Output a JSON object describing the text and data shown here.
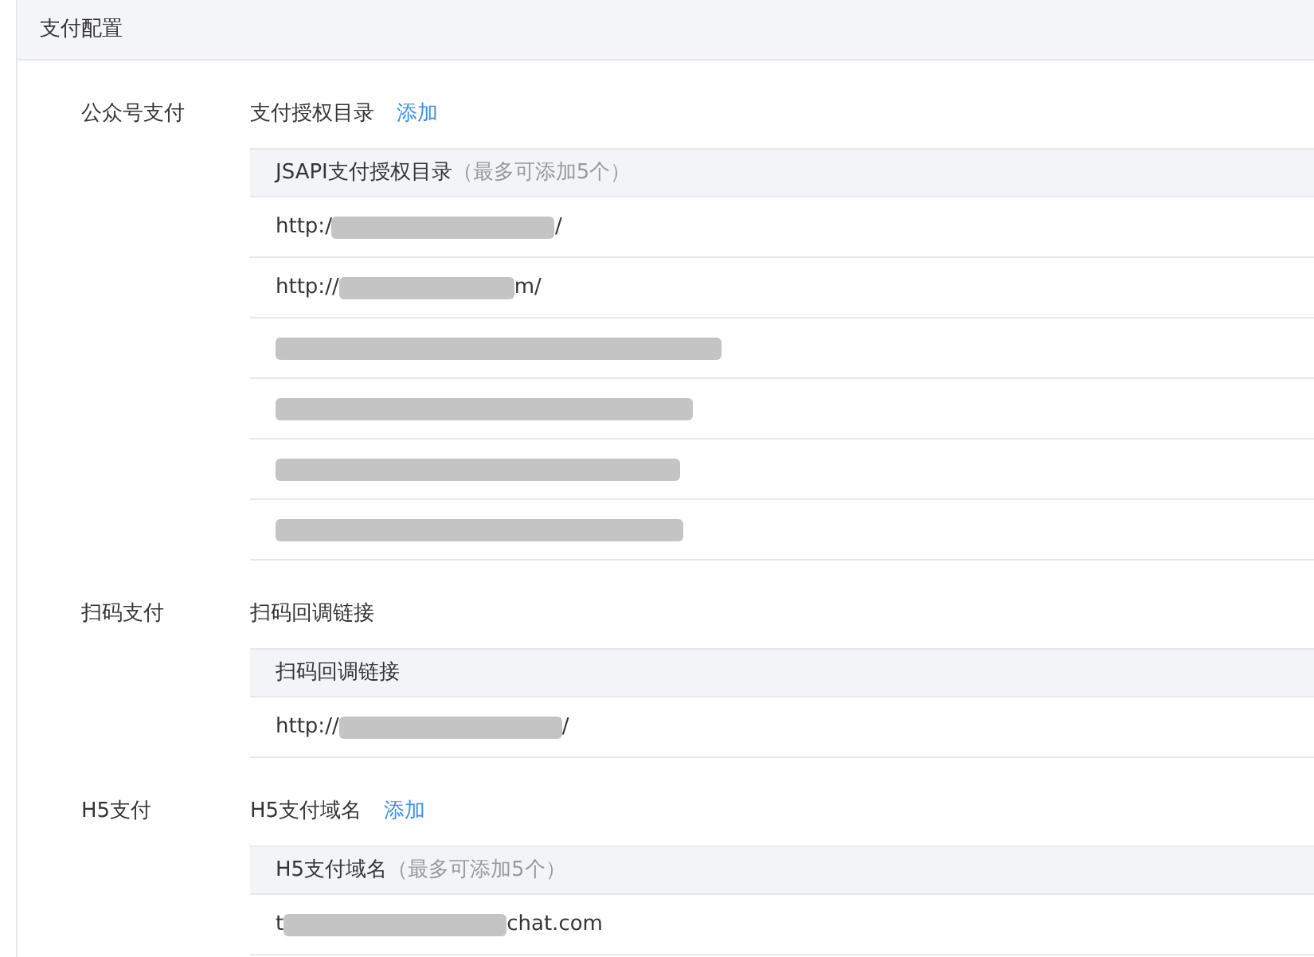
{
  "panel": {
    "title": "支付配置"
  },
  "sections": [
    {
      "label": "公众号支付",
      "title": "支付授权目录",
      "add_link": "添加",
      "table": {
        "header": "JSAPI支付授权目录",
        "header_note": "（最多可添加5个）",
        "rows": [
          {
            "kind": "partial",
            "prefix": "http:/",
            "suffix": "/"
          },
          {
            "kind": "partial",
            "prefix": "http://",
            "suffix": "m/"
          },
          {
            "kind": "redacted"
          },
          {
            "kind": "redacted"
          },
          {
            "kind": "redacted"
          },
          {
            "kind": "redacted"
          }
        ]
      }
    },
    {
      "label": "扫码支付",
      "title": "扫码回调链接",
      "table": {
        "header": "扫码回调链接",
        "rows": [
          {
            "kind": "partial",
            "prefix": "http://",
            "suffix": "/"
          }
        ]
      }
    },
    {
      "label": "H5支付",
      "title": "H5支付域名",
      "add_link": "添加",
      "table": {
        "header": "H5支付域名",
        "header_note": "（最多可添加5个）",
        "rows": [
          {
            "kind": "partial",
            "prefix": "t",
            "suffix": "chat.com"
          }
        ]
      }
    }
  ]
}
